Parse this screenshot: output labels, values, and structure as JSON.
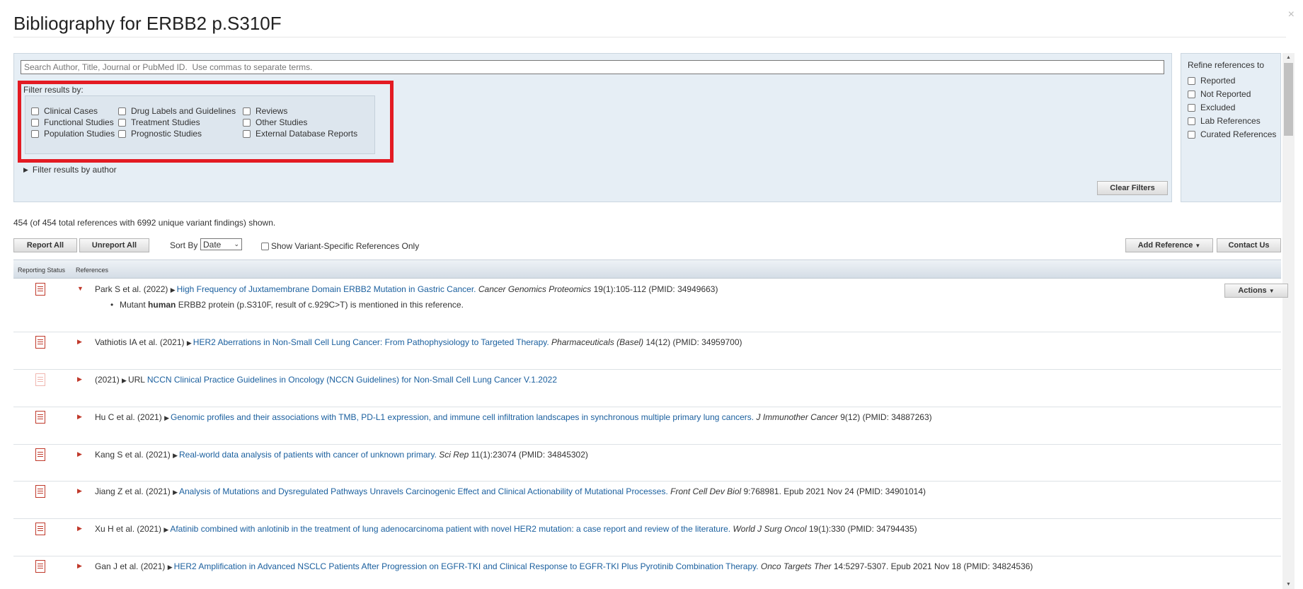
{
  "modal": {
    "title": "Bibliography for ERBB2 p.S310F",
    "close_glyph": "×"
  },
  "search": {
    "placeholder": "Search Author, Title, Journal or PubMed ID.  Use commas to separate terms."
  },
  "filters": {
    "label": "Filter results by:",
    "options": [
      "Clinical Cases",
      "Functional Studies",
      "Population Studies",
      "Drug Labels and Guidelines",
      "Treatment Studies",
      "Prognostic Studies",
      "Reviews",
      "Other Studies",
      "External Database Reports"
    ],
    "author_toggle": "Filter results by author",
    "clear_label": "Clear Filters"
  },
  "refine": {
    "title": "Refine references to",
    "options": [
      "Reported",
      "Not Reported",
      "Excluded",
      "Lab References",
      "Curated References"
    ]
  },
  "summary": "454 (of 454 total references with 6992 unique variant findings) shown.",
  "toolbar": {
    "report_all": "Report All",
    "unreport_all": "Unreport All",
    "sort_by_label": "Sort By",
    "sort_value": "Date",
    "variant_only_label": "Show Variant-Specific References Only",
    "add_reference": "Add Reference",
    "contact_us": "Contact Us"
  },
  "table": {
    "headers": {
      "status": "Reporting Status",
      "refs": "References"
    },
    "actions_label": "Actions",
    "rows": [
      {
        "authors": "Park S et al. (2022)",
        "prefix": "",
        "title": "High Frequency of Juxtamembrane Domain ERBB2 Mutation in Gastric Cancer.",
        "journal": "Cancer Genomics Proteomics",
        "tail": "19(1):105-112 (PMID: 34949663)",
        "detail_pre": "Mutant ",
        "detail_bold": "human",
        "detail_post": " ERBB2 protein (p.S310F, result of c.929C>T) is mentioned in this reference."
      },
      {
        "authors": "Vathiotis IA et al. (2021)",
        "prefix": "",
        "title": "HER2 Aberrations in Non-Small Cell Lung Cancer: From Pathophysiology to Targeted Therapy.",
        "journal": "Pharmaceuticals (Basel)",
        "tail": "14(12) (PMID: 34959700)"
      },
      {
        "authors": "(2021)",
        "prefix": "URL",
        "title": "NCCN Clinical Practice Guidelines in Oncology (NCCN Guidelines) for Non-Small Cell Lung Cancer V.1.2022",
        "journal": "",
        "tail": ""
      },
      {
        "authors": "Hu C et al. (2021)",
        "prefix": "",
        "title": "Genomic profiles and their associations with TMB, PD-L1 expression, and immune cell infiltration landscapes in synchronous multiple primary lung cancers.",
        "journal": "J Immunother Cancer",
        "tail": "9(12) (PMID: 34887263)"
      },
      {
        "authors": "Kang S et al. (2021)",
        "prefix": "",
        "title": "Real-world data analysis of patients with cancer of unknown primary.",
        "journal": "Sci Rep",
        "tail": "11(1):23074 (PMID: 34845302)"
      },
      {
        "authors": "Jiang Z et al. (2021)",
        "prefix": "",
        "title": "Analysis of Mutations and Dysregulated Pathways Unravels Carcinogenic Effect and Clinical Actionability of Mutational Processes.",
        "journal": "Front Cell Dev Biol",
        "tail": "9:768981. Epub 2021 Nov 24 (PMID: 34901014)"
      },
      {
        "authors": "Xu H et al. (2021)",
        "prefix": "",
        "title": "Afatinib combined with anlotinib in the treatment of lung adenocarcinoma patient with novel HER2 mutation: a case report and review of the literature.",
        "journal": "World J Surg Oncol",
        "tail": "19(1):330 (PMID: 34794435)"
      },
      {
        "authors": "Gan J et al. (2021)",
        "prefix": "",
        "title": "HER2 Amplification in Advanced NSCLC Patients After Progression on EGFR-TKI and Clinical Response to EGFR-TKI Plus Pyrotinib Combination Therapy.",
        "journal": "Onco Targets Ther",
        "tail": "14:5297-5307. Epub 2021 Nov 18 (PMID: 34824536)"
      }
    ]
  },
  "colors": {
    "highlight": "#e31b23",
    "link": "#1a5f9e",
    "panel": "#e6eef5"
  },
  "icons": [
    "close-icon",
    "pdf-document-icon",
    "expand-arrow-icon",
    "caret-down-icon"
  ]
}
